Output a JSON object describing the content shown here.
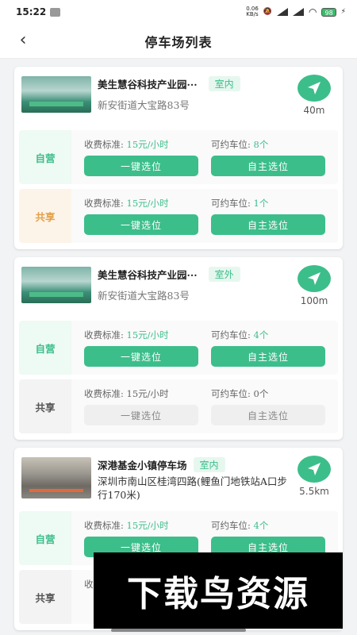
{
  "status_bar": {
    "time": "15:22",
    "net_speed_value": "0.06",
    "net_speed_unit": "KB/s",
    "battery": "98"
  },
  "nav": {
    "title": "停车场列表"
  },
  "labels": {
    "price_label": "收费标准:",
    "spots_label": "可约车位:",
    "one_click": "一键选位",
    "self_select": "自主选位",
    "self_run": "自营",
    "shared": "共享"
  },
  "lots": [
    {
      "name": "美生慧谷科技产业园···",
      "tag": "室内",
      "address": "新安街道大宝路83号",
      "distance": "40m",
      "slots": [
        {
          "type": "自营",
          "price": "15元/小时",
          "spots": "8个"
        },
        {
          "type": "共享",
          "price": "15元/小时",
          "spots": "1个"
        }
      ]
    },
    {
      "name": "美生慧谷科技产业园···",
      "tag": "室外",
      "address": "新安街道大宝路83号",
      "distance": "100m",
      "slots": [
        {
          "type": "自营",
          "price": "15元/小时",
          "spots": "4个"
        },
        {
          "type": "共享",
          "price": "15元/小时",
          "spots": "0个"
        }
      ]
    },
    {
      "name": "深港基金小镇停车场",
      "tag": "室内",
      "address": "深圳市南山区桂湾四路(鲤鱼门地铁站A口步行170米)",
      "distance": "5.5km",
      "slots": [
        {
          "type": "自营",
          "price": "15元/小时",
          "spots": "4个"
        },
        {
          "type": "共享",
          "price": "",
          "spots": ""
        }
      ]
    }
  ],
  "watermark": "下载鸟资源",
  "colors": {
    "accent": "#3cbe8b",
    "shared": "#e3a04a"
  }
}
